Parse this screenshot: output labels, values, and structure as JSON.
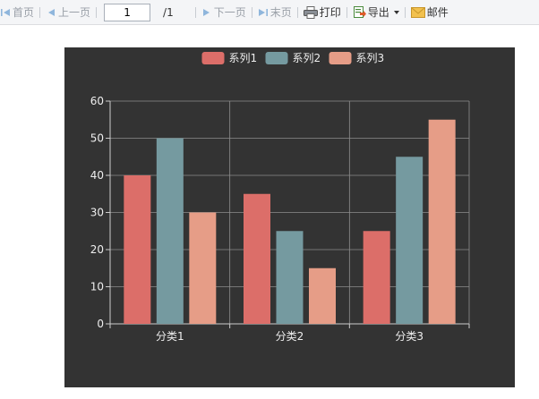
{
  "toolbar": {
    "first_label": "首页",
    "prev_label": "上一页",
    "page_value": "1",
    "page_total": "/1",
    "next_label": "下一页",
    "last_label": "末页",
    "print_label": "打印",
    "export_label": "导出",
    "email_label": "邮件"
  },
  "chart_data": {
    "type": "bar",
    "title": "",
    "xlabel": "",
    "ylabel": "",
    "categories": [
      "分类1",
      "分类2",
      "分类3"
    ],
    "series": [
      {
        "name": "系列1",
        "color": "#dc6e69",
        "values": [
          40,
          35,
          25
        ]
      },
      {
        "name": "系列2",
        "color": "#759aa0",
        "values": [
          50,
          25,
          45
        ]
      },
      {
        "name": "系列3",
        "color": "#e69d87",
        "values": [
          30,
          15,
          55
        ]
      }
    ],
    "ylim": [
      0,
      60
    ],
    "yticks": [
      "0",
      "10",
      "20",
      "30",
      "40",
      "50",
      "60"
    ],
    "grid": true,
    "legend": "top-center",
    "background": "#333333"
  }
}
